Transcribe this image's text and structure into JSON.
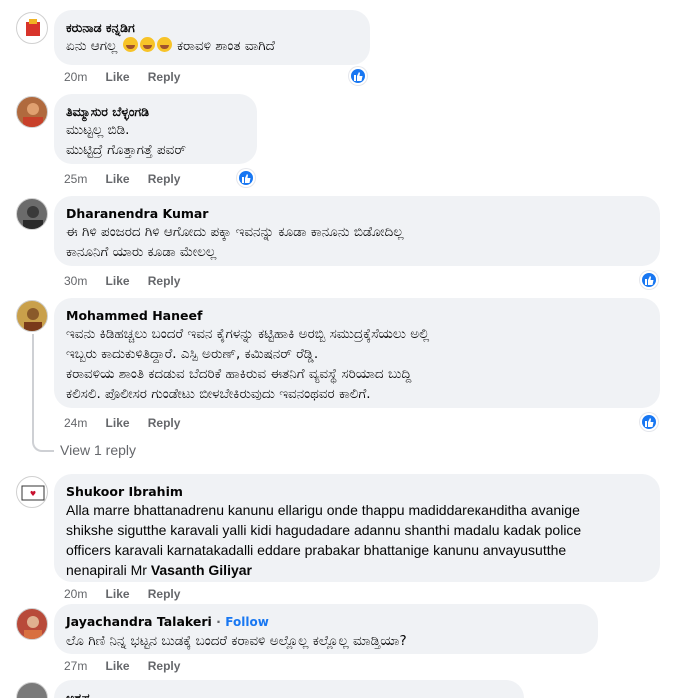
{
  "comments": [
    {
      "author": "ಕರುನಾಡ ಕನ್ನಡಿಗ",
      "lines": [
        "ಏನು ಆಗಲ್ಲ",
        "ಕರಾವಳಿ ಶಾಂತ ವಾಗಿದೆ"
      ],
      "time": "20m",
      "like": "Like",
      "reply": "Reply"
    },
    {
      "author": "ತಿಮ್ಮಾಸುರ ಬೆಳ್ಳಂಗಡಿ",
      "lines": [
        "ಮುಟ್ಟಲ್ಲ ಬಿಡಿ.",
        "ಮುಟ್ಟಿದ್ರೆ ಗೊತ್ತಾಗತ್ತೆ ಪವರ್"
      ],
      "time": "25m",
      "like": "Like",
      "reply": "Reply"
    },
    {
      "author": "Dharanendra Kumar",
      "lines": [
        "ಈ ಗಿಳಿ ಪಂಜರದ ಗಿಳಿ ಆಗೋದು ಪಕ್ಕಾ ಇವನನ್ನು ಕೂಡಾ ಕಾನೂನು ಬಿಡೋದಿಲ್ಲ",
        "ಕಾನೂನಿಗೆ ಯಾರು ಕೂಡಾ ಮೇಲಲ್ಲ"
      ],
      "time": "30m",
      "like": "Like",
      "reply": "Reply"
    },
    {
      "author": "Mohammed Haneef",
      "lines": [
        "ಇವನು ಕಿಡಿಹಚ್ಚಲು ಬಂದರೆ ಇವನ ಕೈಗಳನ್ನು ಕಟ್ಟಿಹಾಕಿ ಅರಬ್ಬಿ ಸಮುದ್ರಕ್ಕೆಸೆಯಲು ಅಲ್ಲಿ",
        "ಇಬ್ಬರು ಕಾದುಕುಳಿತಿದ್ದಾರೆ. ಎಸ್ಪಿ ಅರುಣ್, ಕಮಿಷನರ್ ರೆಡ್ಡಿ.",
        "ಕರಾವಳಿಯ ಶಾಂತಿ ಕದಡುವ ಬೆದರಿಕೆ ಹಾಕಿರುವ ಈತನಿಗೆ ವ್ಯವಸ್ಥೆ ಸರಿಯಾದ ಬುದ್ದಿ",
        "ಕಲಿಸಲಿ. ಪೊಲೀಸರ ಗುಂಡೇಟು ಬೀಳಬೇಕಿರುವುದು ಇವನಂಥವರ ಕಾಲಿಗೆ."
      ],
      "time": "24m",
      "like": "Like",
      "reply": "Reply"
    },
    {
      "author": "Shukoor Ibrahim",
      "lines": [
        "Alla marre bhattanadrenu kanunu ellarigu onde thappu madiddareканditha avanige",
        "shikshe sigutthe karavali yalli kidi hagudadare adannu shanthi madalu kadak police",
        "officers karavali karnatakadalli eddare prabakar bhattanige kanunu anvayusutthe",
        "nenapirali Mr"
      ],
      "mention": "Vasanth Giliyar",
      "time": "20m",
      "like": "Like",
      "reply": "Reply"
    },
    {
      "author": "Jayachandra Talakeri",
      "follow": "Follow",
      "lines": [
        "ಲೊ ಗಿಣಿ ನಿನ್ನ ಭಟ್ಟನ ಬುಡಕ್ಕೆ ಬಂದರೆ ಕರಾವಳಿ ಅಲ್ಲೊಲ್ಲ ಕಲ್ಲೊಲ್ಲ ಮಾಡ್ತಿಯಾ?"
      ],
      "time": "27m",
      "like": "Like",
      "reply": "Reply"
    },
    {
      "author": "ಅಶ್ರಫ಼"
    }
  ],
  "view_replies": "View 1 reply",
  "colors": {
    "bubble": "#f0f2f5",
    "meta": "#65676b",
    "accent": "#1877f2"
  }
}
